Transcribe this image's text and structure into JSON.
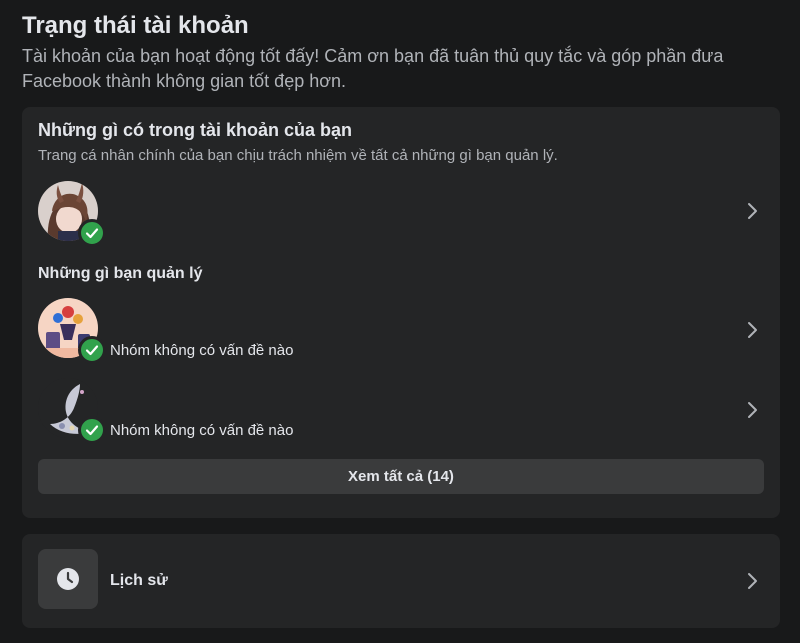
{
  "header": {
    "title": "Trạng thái tài khoản",
    "subtitle": "Tài khoản của bạn hoạt động tốt đấy! Cảm ơn bạn đã tuân thủ quy tắc và góp phần đưa Facebook thành không gian tốt đẹp hơn."
  },
  "account_section": {
    "title": "Những gì có trong tài khoản của bạn",
    "description": "Trang cá nhân chính của bạn chịu trách nhiệm về tất cả những gì bạn quản lý.",
    "profile": {
      "status_icon": "check-icon",
      "status_color": "#31a24c"
    },
    "managed_heading": "Những gì bạn quản lý",
    "managed_items": [
      {
        "status_text": "Nhóm không có vấn đề nào",
        "status_icon": "check-icon"
      },
      {
        "status_text": "Nhóm không có vấn đề nào",
        "status_icon": "check-icon"
      }
    ],
    "see_all_label": "Xem tất cả (14)"
  },
  "history": {
    "label": "Lịch sử",
    "icon": "clock-icon"
  },
  "colors": {
    "background": "#18191a",
    "card": "#242526",
    "button": "#3a3b3c",
    "success": "#31a24c",
    "text_primary": "#e4e6eb",
    "text_secondary": "#b0b3b8"
  }
}
